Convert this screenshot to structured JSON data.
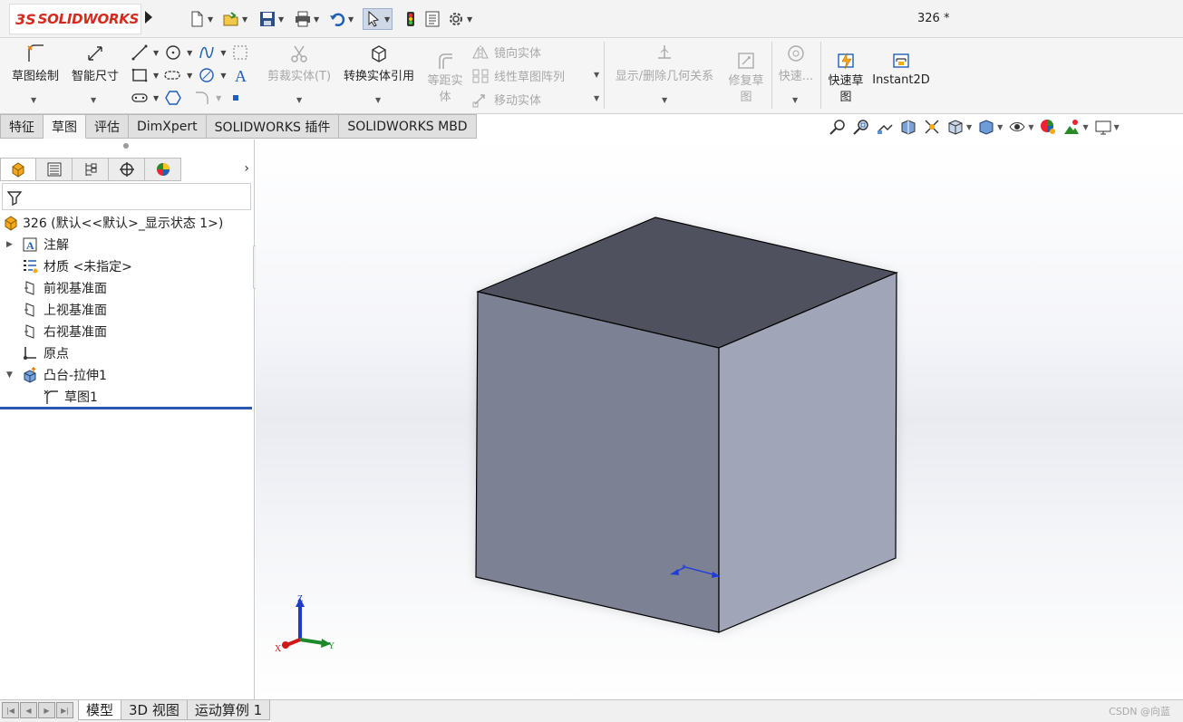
{
  "app": {
    "logo_prefix": "3S",
    "logo_brand": "SOLIDWORKS",
    "document_title": "326 *"
  },
  "ribbon": {
    "sketch": "草图绘制",
    "smart_dimension": "智能尺寸",
    "trim_entities": "剪裁实体(T)",
    "convert_entities": "转换实体引用",
    "offset_entities_line1": "等距实",
    "offset_entities_line2": "体",
    "mirror_entities": "镜向实体",
    "linear_pattern": "线性草图阵列",
    "move_entities": "移动实体",
    "display_relations": "显示/删除几何关系",
    "repair_sketch_line1": "修复草",
    "repair_sketch_line2": "图",
    "quick_snaps": "快速...",
    "rapid_sketch_line1": "快速草",
    "rapid_sketch_line2": "图",
    "instant2d": "Instant2D"
  },
  "tabs": [
    {
      "label": "特征",
      "active": false
    },
    {
      "label": "草图",
      "active": true
    },
    {
      "label": "评估",
      "active": false
    },
    {
      "label": "DimXpert",
      "active": false
    },
    {
      "label": "SOLIDWORKS 插件",
      "active": false
    },
    {
      "label": "SOLIDWORKS MBD",
      "active": false
    }
  ],
  "tree": {
    "root": "326  (默认<<默认>_显示状态 1>)",
    "annotations": "注解",
    "material": "材质 <未指定>",
    "front_plane": "前视基准面",
    "top_plane": "上视基准面",
    "right_plane": "右视基准面",
    "origin": "原点",
    "boss_extrude": "凸台-拉伸1",
    "sketch1": "草图1"
  },
  "triad": {
    "x": "X",
    "y": "Y",
    "z": "Z"
  },
  "bottom_tabs": [
    {
      "label": "模型",
      "active": true
    },
    {
      "label": "3D 视图",
      "active": false
    },
    {
      "label": "运动算例 1",
      "active": false
    }
  ],
  "watermark": "CSDN @向蓝",
  "colors": {
    "cube_top": "#4f525e",
    "cube_front": "#7d8194",
    "cube_right": "#a1a5b8",
    "brand_red": "#d52b1e",
    "rollback_bar": "#2a56b3"
  }
}
